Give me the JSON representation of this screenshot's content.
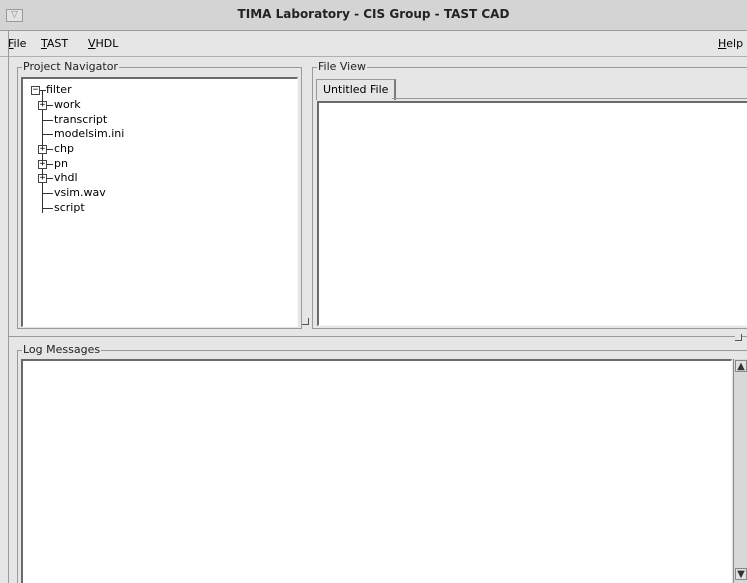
{
  "window": {
    "title": "TIMA Laboratory - CIS Group - TAST CAD",
    "title_button_glyph": "▽"
  },
  "menu": {
    "file": "File",
    "tast": "TAST",
    "vhdl": "VHDL",
    "help": "Help"
  },
  "project_navigator": {
    "label": "Project Navigator",
    "root": "filter",
    "items": [
      {
        "label": "work",
        "expandable": true
      },
      {
        "label": "transcript",
        "expandable": false
      },
      {
        "label": "modelsim.ini",
        "expandable": false
      },
      {
        "label": "chp",
        "expandable": true
      },
      {
        "label": "pn",
        "expandable": true
      },
      {
        "label": "vhdl",
        "expandable": true
      },
      {
        "label": "vsim.wav",
        "expandable": false
      },
      {
        "label": "script",
        "expandable": false
      }
    ]
  },
  "file_view": {
    "label": "File View",
    "tabs": [
      "Untitled File"
    ]
  },
  "log_messages": {
    "label": "Log Messages"
  },
  "colors": {
    "background": "#e6e6e6",
    "panel": "#ffffff",
    "border": "#9a9a9a"
  }
}
